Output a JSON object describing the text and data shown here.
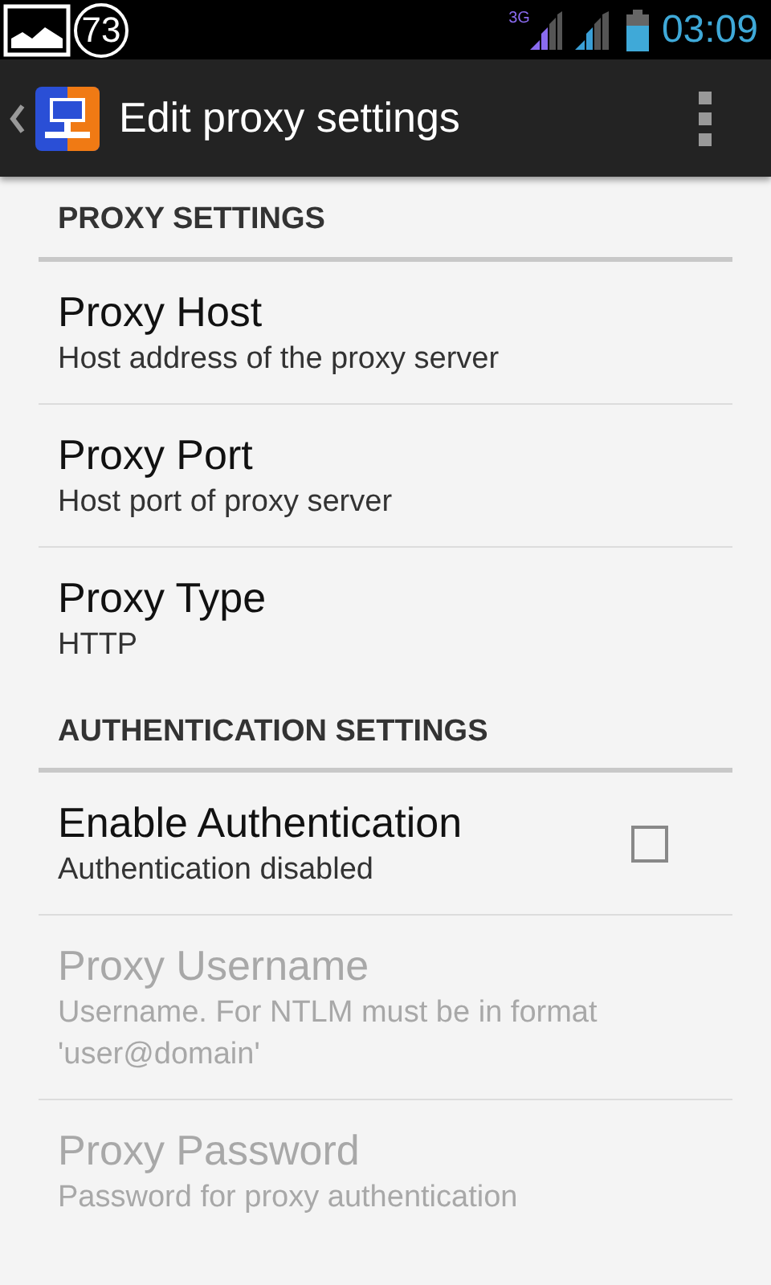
{
  "status_bar": {
    "notification_count": "73",
    "network": "3G",
    "time": "03:09"
  },
  "action_bar": {
    "title": "Edit proxy settings"
  },
  "sections": [
    {
      "title": "PROXY SETTINGS",
      "items": [
        {
          "kind": "text",
          "title": "Proxy Host",
          "summary": "Host address of the proxy server",
          "disabled": false
        },
        {
          "kind": "text",
          "title": "Proxy Port",
          "summary": "Host port of proxy server",
          "disabled": false
        },
        {
          "kind": "text",
          "title": "Proxy Type",
          "summary": "HTTP",
          "disabled": false
        }
      ]
    },
    {
      "title": "AUTHENTICATION SETTINGS",
      "items": [
        {
          "kind": "checkbox",
          "title": "Enable Authentication",
          "summary": "Authentication disabled",
          "disabled": false,
          "checked": false
        },
        {
          "kind": "text",
          "title": "Proxy Username",
          "summary": "Username. For NTLM must be in format 'user@domain'",
          "disabled": true
        },
        {
          "kind": "text",
          "title": "Proxy Password",
          "summary": "Password for proxy authentication",
          "disabled": true
        }
      ]
    }
  ]
}
